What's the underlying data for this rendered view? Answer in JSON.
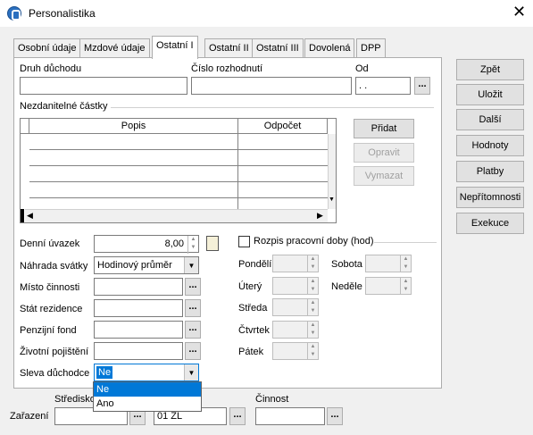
{
  "window": {
    "title": "Personalistika",
    "icon": "app-icon"
  },
  "tabs": [
    "Osobní údaje",
    "Mzdové údaje",
    "Ostatní I",
    "Ostatní II",
    "Ostatní III",
    "Dovolená",
    "DPP"
  ],
  "active_tab": "Ostatní I",
  "top_fields": {
    "druh_label": "Druh důchodu",
    "cislo_label": "Číslo rozhodnutí",
    "od_label": "Od",
    "od_value": "  .  .  "
  },
  "nezdanitelne": {
    "label": "Nezdanitelné částky",
    "col_popis": "Popis",
    "col_odpocet": "Odpočet"
  },
  "grid_buttons": {
    "pridat": "Přidat",
    "opravit": "Opravit",
    "vymazat": "Vymazat"
  },
  "left_fields": {
    "denni_uvazek_label": "Denní úvazek",
    "denni_uvazek_value": "8,00",
    "nahrada_label": "Náhrada svátky",
    "nahrada_value": "Hodinový průměr",
    "misto_label": "Místo činnosti",
    "stat_label": "Stát rezidence",
    "penzijni_label": "Penzijní fond",
    "zivotni_label": "Životní pojištění",
    "sleva_label": "Sleva důchodce",
    "sleva_value": "Ne"
  },
  "dropdown_options": [
    "Ne",
    "Ano"
  ],
  "rozpis": {
    "label": "Rozpis pracovní doby (hod)",
    "days": [
      "Pondělí",
      "Úterý",
      "Středa",
      "Čtvrtek",
      "Pátek",
      "Sobota",
      "Neděle"
    ]
  },
  "bottom": {
    "zarazeni_label": "Zařazení",
    "stredisko_label": "Středisko",
    "stredisko_value": "01 ZL",
    "cinnost_label": "Činnost"
  },
  "right_buttons": [
    "Zpět",
    "Uložit",
    "Další",
    "Hodnoty",
    "Platby",
    "Nepřítomnosti",
    "Exekuce"
  ],
  "colors": {
    "selected": "#0078d7",
    "accent": "#2a6fbf"
  }
}
